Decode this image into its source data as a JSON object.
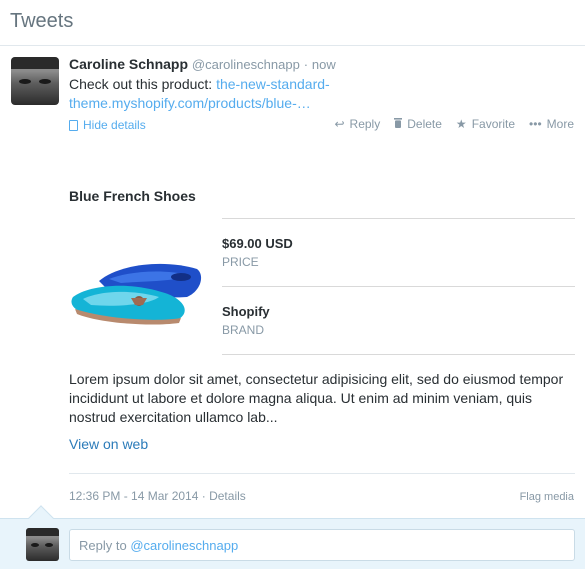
{
  "header": {
    "title": "Tweets"
  },
  "tweet": {
    "fullname": "Caroline Schnapp",
    "username": "@carolineschnapp",
    "separator": "·",
    "timestamp": "now",
    "text_prefix": "Check out this product: ",
    "link_text_1": "the-new-standard-",
    "link_text_2": "theme.myshopify.com/products/blue-…",
    "hide_details": "Hide details",
    "actions": [
      {
        "label": "Reply",
        "icon": "reply-icon"
      },
      {
        "label": "Delete",
        "icon": "trash-icon"
      },
      {
        "label": "Favorite",
        "icon": "star-icon"
      },
      {
        "label": "More",
        "icon": "more-icon"
      }
    ]
  },
  "card": {
    "title": "Blue French Shoes",
    "fields": [
      {
        "value": "$69.00 USD",
        "label": "PRICE"
      },
      {
        "value": "Shopify",
        "label": "BRAND"
      }
    ],
    "description": "Lorem ipsum dolor sit amet, consectetur adipisicing elit, sed do eiusmod tempor incididunt ut labore et dolore magna aliqua. Ut enim ad minim veniam, quis nostrud exercitation ullamco lab...",
    "view_link": "View on web"
  },
  "footer": {
    "datetime": "12:36 PM - 14 Mar 2014",
    "separator": "·",
    "details": "Details",
    "flag": "Flag media"
  },
  "reply": {
    "prefix": "Reply to ",
    "target": "@carolineschnapp"
  }
}
